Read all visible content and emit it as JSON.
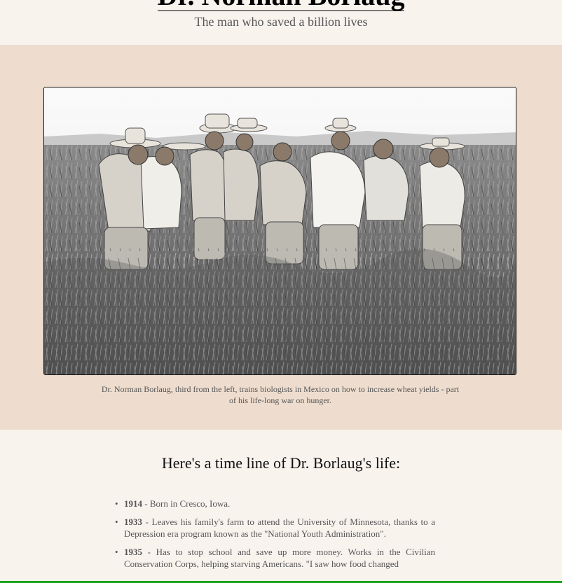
{
  "header": {
    "title": "Dr. Norman Borlaug",
    "subtitle": "The man who saved a billion lives"
  },
  "photo": {
    "caption": "Dr. Norman Borlaug, third from the left, trains biologists in Mexico on how to increase wheat yields - part of his life-long war on hunger."
  },
  "timeline": {
    "heading": "Here's a time line of Dr. Borlaug's life:",
    "items": [
      {
        "year": "1914",
        "text": " - Born in Cresco, Iowa."
      },
      {
        "year": "1933",
        "text": " - Leaves his family's farm to attend the University of Minnesota, thanks to a Depression era program known as the \"National Youth Administration\"."
      },
      {
        "year": "1935",
        "text": " - Has to stop school and save up more money. Works in the Civilian Conservation Corps, helping starving Americans. \"I saw how food changed"
      }
    ]
  },
  "colors": {
    "page_bg": "#f9f3ee",
    "photo_section_bg": "#eeddce",
    "text": "#555555",
    "bottom_bar": "#1aa51a"
  }
}
